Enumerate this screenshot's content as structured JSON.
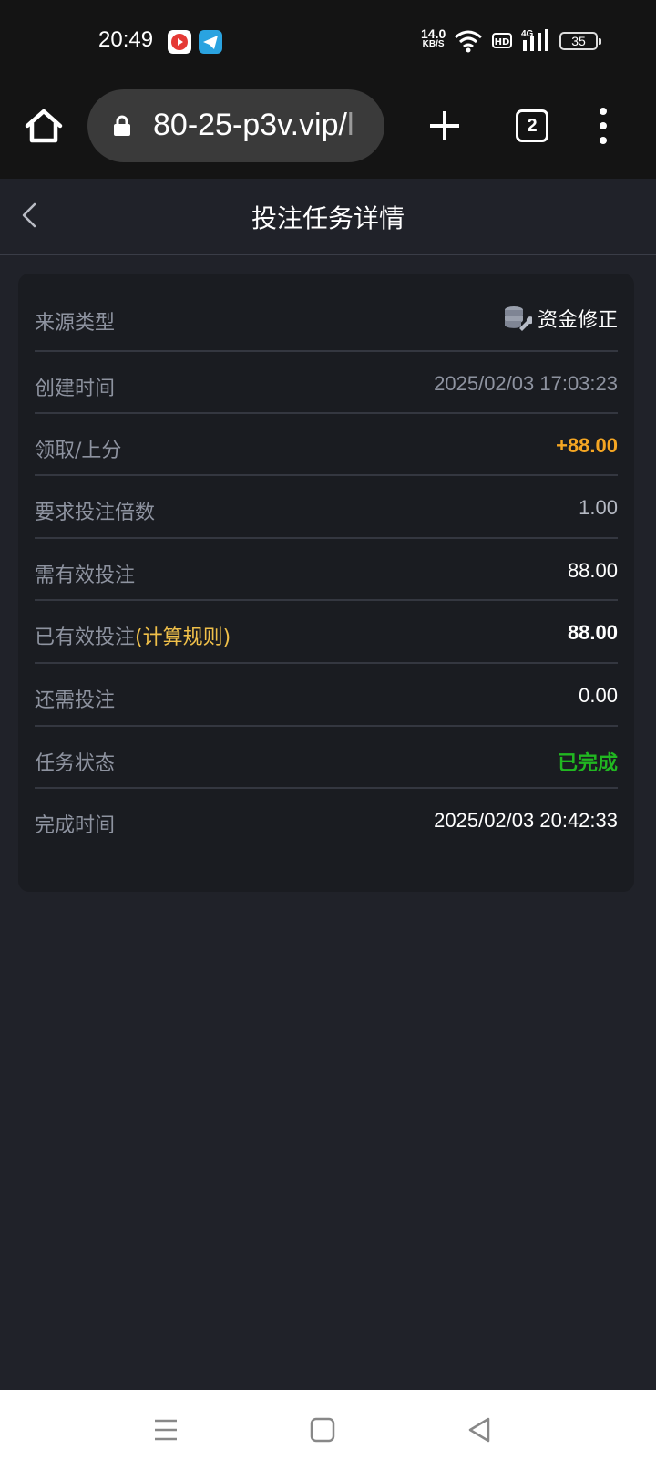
{
  "status_bar": {
    "time": "20:49",
    "net_speed_value": "14.0",
    "net_speed_unit": "KB/S",
    "hd": "HD",
    "network": "4G",
    "battery": "35"
  },
  "browser": {
    "url_main": "80-25-p3v.vip/",
    "url_tail": "l",
    "tab_count": "2"
  },
  "header": {
    "title": "投注任务详情"
  },
  "details": {
    "source_type_label": "来源类型",
    "source_type_value": "资金修正",
    "created_label": "创建时间",
    "created_value": "2025/02/03 17:03:23",
    "claim_label": "领取/上分",
    "claim_value": "+88.00",
    "multiplier_label": "要求投注倍数",
    "multiplier_value": "1.00",
    "required_label": "需有效投注",
    "required_value": "88.00",
    "done_label": "已有效投注",
    "calc_rule_link": "(计算规则)",
    "done_value": "88.00",
    "remaining_label": "还需投注",
    "remaining_value": "0.00",
    "status_label": "任务状态",
    "status_value": "已完成",
    "finish_label": "完成时间",
    "finish_value": "2025/02/03 20:42:33"
  },
  "colors": {
    "accent_orange": "#f5a623",
    "status_green": "#21b721",
    "link_yellow": "#f0c04a"
  }
}
